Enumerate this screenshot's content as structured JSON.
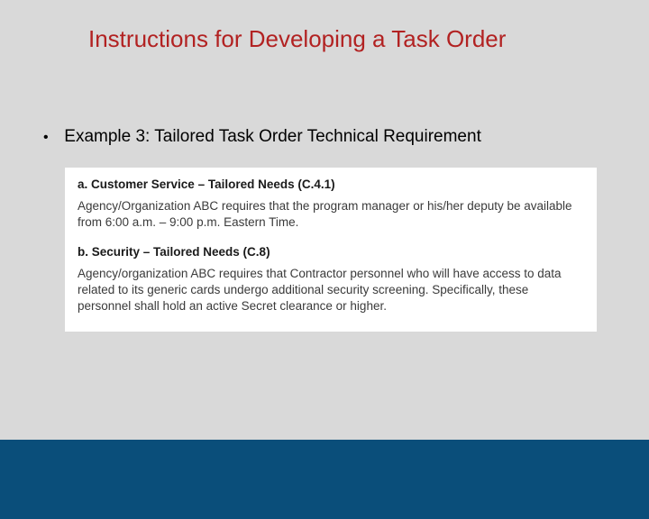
{
  "title": "Instructions for Developing a Task Order",
  "bullet": {
    "marker": "•",
    "text": "Example 3: Tailored Task Order Technical Requirement"
  },
  "inset": {
    "section_a": {
      "heading": "a. Customer Service – Tailored Needs (C.4.1)",
      "body": "Agency/Organization ABC requires that the program manager or his/her deputy be available from 6:00 a.m. – 9:00 p.m. Eastern Time."
    },
    "section_b": {
      "heading": "b. Security – Tailored Needs (C.8)",
      "body": "Agency/organization ABC requires that Contractor personnel who will have access to data related to its generic cards undergo additional security screening.  Specifically, these personnel shall hold an active Secret clearance or higher."
    }
  },
  "colors": {
    "title": "#b22222",
    "background": "#d9d9d9",
    "footer": "#0a4e7a"
  }
}
